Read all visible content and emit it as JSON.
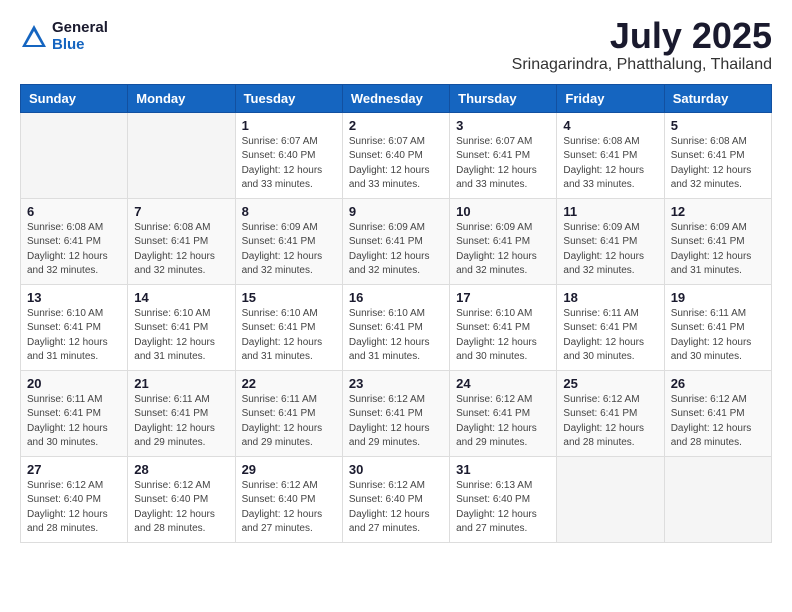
{
  "header": {
    "logo_general": "General",
    "logo_blue": "Blue",
    "month": "July 2025",
    "location": "Srinagarindra, Phatthalung, Thailand"
  },
  "weekdays": [
    "Sunday",
    "Monday",
    "Tuesday",
    "Wednesday",
    "Thursday",
    "Friday",
    "Saturday"
  ],
  "weeks": [
    [
      {
        "day": "",
        "detail": ""
      },
      {
        "day": "",
        "detail": ""
      },
      {
        "day": "1",
        "detail": "Sunrise: 6:07 AM\nSunset: 6:40 PM\nDaylight: 12 hours\nand 33 minutes."
      },
      {
        "day": "2",
        "detail": "Sunrise: 6:07 AM\nSunset: 6:40 PM\nDaylight: 12 hours\nand 33 minutes."
      },
      {
        "day": "3",
        "detail": "Sunrise: 6:07 AM\nSunset: 6:41 PM\nDaylight: 12 hours\nand 33 minutes."
      },
      {
        "day": "4",
        "detail": "Sunrise: 6:08 AM\nSunset: 6:41 PM\nDaylight: 12 hours\nand 33 minutes."
      },
      {
        "day": "5",
        "detail": "Sunrise: 6:08 AM\nSunset: 6:41 PM\nDaylight: 12 hours\nand 32 minutes."
      }
    ],
    [
      {
        "day": "6",
        "detail": "Sunrise: 6:08 AM\nSunset: 6:41 PM\nDaylight: 12 hours\nand 32 minutes."
      },
      {
        "day": "7",
        "detail": "Sunrise: 6:08 AM\nSunset: 6:41 PM\nDaylight: 12 hours\nand 32 minutes."
      },
      {
        "day": "8",
        "detail": "Sunrise: 6:09 AM\nSunset: 6:41 PM\nDaylight: 12 hours\nand 32 minutes."
      },
      {
        "day": "9",
        "detail": "Sunrise: 6:09 AM\nSunset: 6:41 PM\nDaylight: 12 hours\nand 32 minutes."
      },
      {
        "day": "10",
        "detail": "Sunrise: 6:09 AM\nSunset: 6:41 PM\nDaylight: 12 hours\nand 32 minutes."
      },
      {
        "day": "11",
        "detail": "Sunrise: 6:09 AM\nSunset: 6:41 PM\nDaylight: 12 hours\nand 32 minutes."
      },
      {
        "day": "12",
        "detail": "Sunrise: 6:09 AM\nSunset: 6:41 PM\nDaylight: 12 hours\nand 31 minutes."
      }
    ],
    [
      {
        "day": "13",
        "detail": "Sunrise: 6:10 AM\nSunset: 6:41 PM\nDaylight: 12 hours\nand 31 minutes."
      },
      {
        "day": "14",
        "detail": "Sunrise: 6:10 AM\nSunset: 6:41 PM\nDaylight: 12 hours\nand 31 minutes."
      },
      {
        "day": "15",
        "detail": "Sunrise: 6:10 AM\nSunset: 6:41 PM\nDaylight: 12 hours\nand 31 minutes."
      },
      {
        "day": "16",
        "detail": "Sunrise: 6:10 AM\nSunset: 6:41 PM\nDaylight: 12 hours\nand 31 minutes."
      },
      {
        "day": "17",
        "detail": "Sunrise: 6:10 AM\nSunset: 6:41 PM\nDaylight: 12 hours\nand 30 minutes."
      },
      {
        "day": "18",
        "detail": "Sunrise: 6:11 AM\nSunset: 6:41 PM\nDaylight: 12 hours\nand 30 minutes."
      },
      {
        "day": "19",
        "detail": "Sunrise: 6:11 AM\nSunset: 6:41 PM\nDaylight: 12 hours\nand 30 minutes."
      }
    ],
    [
      {
        "day": "20",
        "detail": "Sunrise: 6:11 AM\nSunset: 6:41 PM\nDaylight: 12 hours\nand 30 minutes."
      },
      {
        "day": "21",
        "detail": "Sunrise: 6:11 AM\nSunset: 6:41 PM\nDaylight: 12 hours\nand 29 minutes."
      },
      {
        "day": "22",
        "detail": "Sunrise: 6:11 AM\nSunset: 6:41 PM\nDaylight: 12 hours\nand 29 minutes."
      },
      {
        "day": "23",
        "detail": "Sunrise: 6:12 AM\nSunset: 6:41 PM\nDaylight: 12 hours\nand 29 minutes."
      },
      {
        "day": "24",
        "detail": "Sunrise: 6:12 AM\nSunset: 6:41 PM\nDaylight: 12 hours\nand 29 minutes."
      },
      {
        "day": "25",
        "detail": "Sunrise: 6:12 AM\nSunset: 6:41 PM\nDaylight: 12 hours\nand 28 minutes."
      },
      {
        "day": "26",
        "detail": "Sunrise: 6:12 AM\nSunset: 6:41 PM\nDaylight: 12 hours\nand 28 minutes."
      }
    ],
    [
      {
        "day": "27",
        "detail": "Sunrise: 6:12 AM\nSunset: 6:40 PM\nDaylight: 12 hours\nand 28 minutes."
      },
      {
        "day": "28",
        "detail": "Sunrise: 6:12 AM\nSunset: 6:40 PM\nDaylight: 12 hours\nand 28 minutes."
      },
      {
        "day": "29",
        "detail": "Sunrise: 6:12 AM\nSunset: 6:40 PM\nDaylight: 12 hours\nand 27 minutes."
      },
      {
        "day": "30",
        "detail": "Sunrise: 6:12 AM\nSunset: 6:40 PM\nDaylight: 12 hours\nand 27 minutes."
      },
      {
        "day": "31",
        "detail": "Sunrise: 6:13 AM\nSunset: 6:40 PM\nDaylight: 12 hours\nand 27 minutes."
      },
      {
        "day": "",
        "detail": ""
      },
      {
        "day": "",
        "detail": ""
      }
    ]
  ]
}
